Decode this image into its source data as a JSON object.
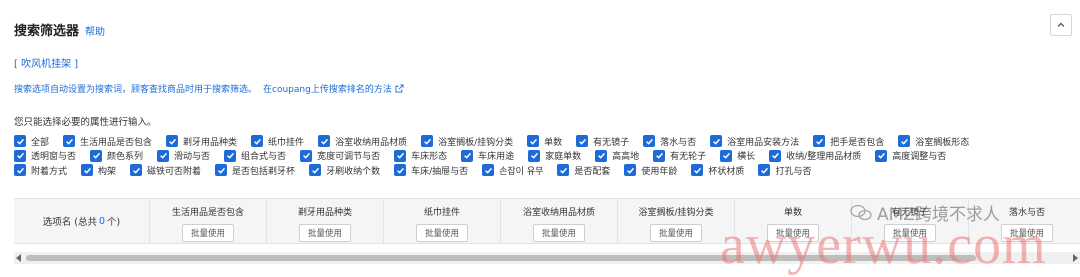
{
  "header": {
    "title": "搜索筛选器",
    "help": "帮助"
  },
  "category": "[ 吹风机挂架 ]",
  "hint": {
    "text": "搜索选项自动设置为搜索词，顾客查找商品时用于搜索筛选。",
    "link": "在coupang上传搜索排名的方法"
  },
  "select_hint": "您只能选择必要的属性进行输入。",
  "attribute_rows": [
    [
      "全部",
      "生活用品是否包含",
      "剃牙用品种类",
      "纸巾挂件",
      "浴室收纳用品材质",
      "浴室搁板/挂钩分类",
      "单数",
      "有无镜子",
      "落水与否",
      "浴室用品安装方法",
      "把手是否包含",
      "浴室搁板形态"
    ],
    [
      "透明窗与否",
      "颜色系列",
      "滑动与否",
      "组合式与否",
      "宽度可调节与否",
      "车床形态",
      "车床用途",
      "家庭单数",
      "高高地",
      "有无轮子",
      "横长",
      "收纳/整理用品材质",
      "高度调整与否"
    ],
    [
      "附着方式",
      "构架",
      "磁铁可否附着",
      "是否包括剃牙杯",
      "牙刷收纳个数",
      "车床/抽屉与否",
      "손잡이 유무",
      "是否配套",
      "使用年龄",
      "杯状材质",
      "打孔与否"
    ]
  ],
  "table": {
    "first_col_label": "选项名 (总共",
    "first_col_count": "0",
    "first_col_suffix": "个)",
    "columns": [
      "生活用品是否包含",
      "剃牙用品种类",
      "纸巾挂件",
      "浴室收纳用品材质",
      "浴室搁板/挂钩分类",
      "单数",
      "有无镜子",
      "落水与否"
    ],
    "batch_label": "批量使用"
  },
  "watermark": {
    "line": "AMZ跨境不求人",
    "text": "awyerwu.com"
  },
  "icons": {
    "collapse": "chevron-up-icon",
    "external": "external-link-icon",
    "check": "check-icon"
  },
  "colors": {
    "accent": "#1c6bd8",
    "watermark": "#e87878"
  }
}
